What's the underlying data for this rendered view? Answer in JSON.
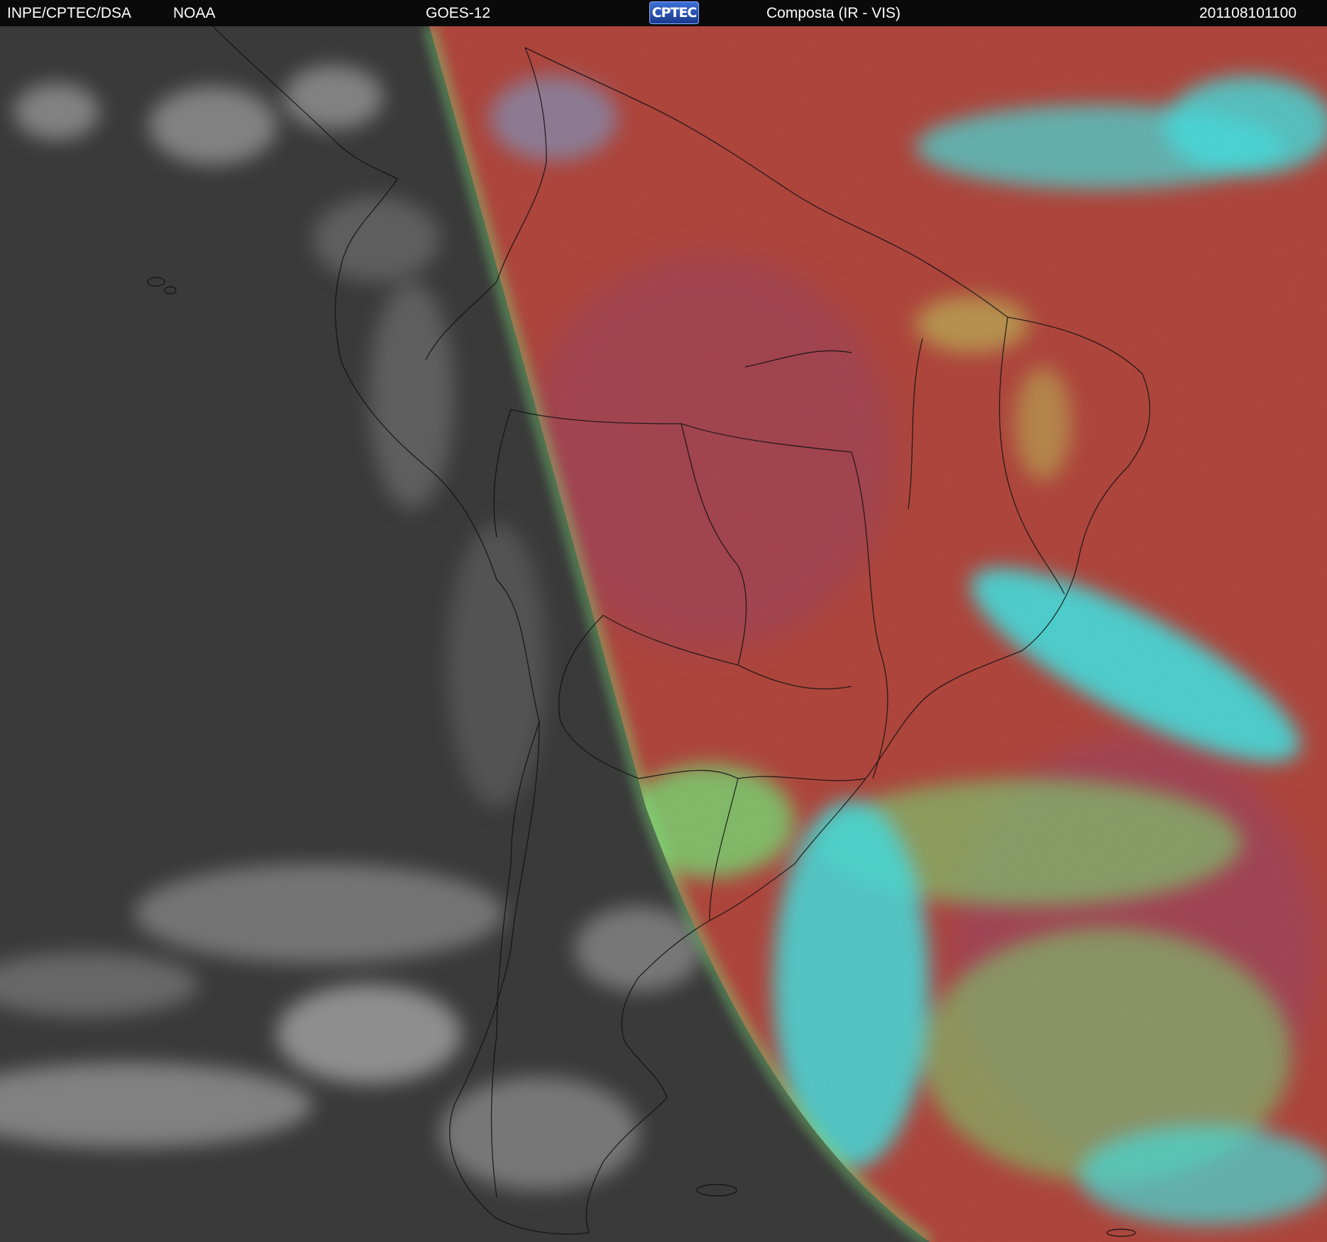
{
  "header": {
    "source": "INPE/CPTEC/DSA",
    "agency": "NOAA",
    "satellite": "GOES-12",
    "logo_text": "CPTEC",
    "product": "Composta (IR - VIS)",
    "timestamp": "201108101100"
  },
  "map": {
    "night_color": "#3a3a3a",
    "day_land_color": "#b84a40",
    "cloud_colors": [
      "#48e8e8",
      "#7ee27a",
      "#bdbdbd"
    ],
    "border_color": "#111111"
  }
}
